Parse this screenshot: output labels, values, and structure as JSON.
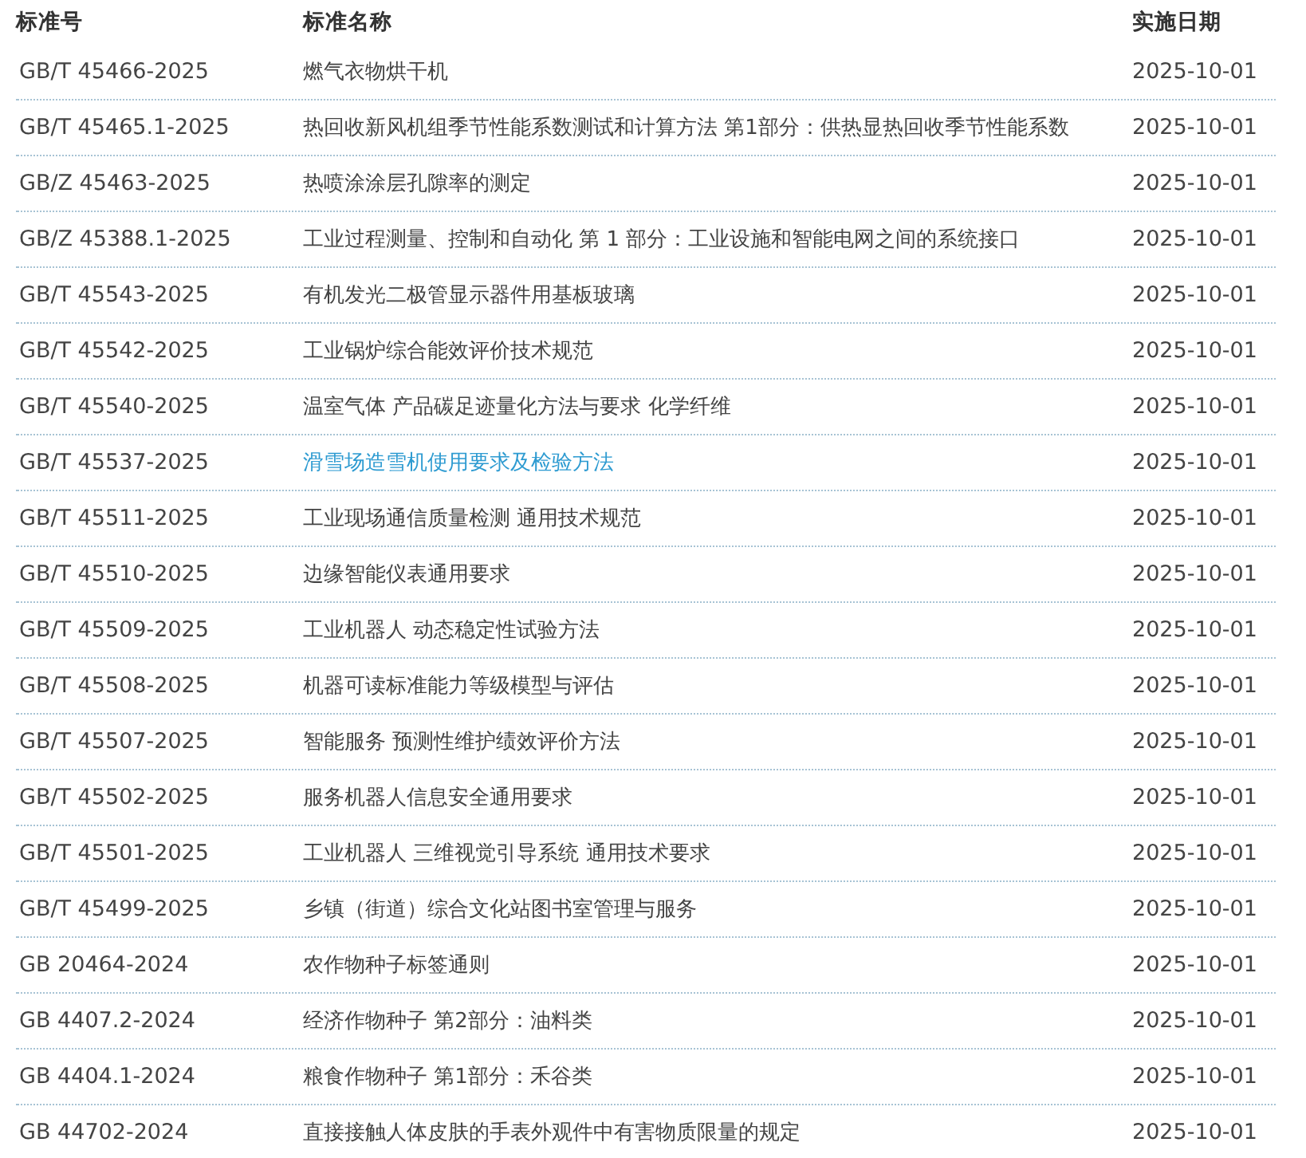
{
  "table": {
    "columns": [
      "标准号",
      "标准名称",
      "实施日期"
    ],
    "rows": [
      {
        "code": "GB/T 45466-2025",
        "name": "燃气衣物烘干机",
        "date": "2025-10-01",
        "highlighted": false
      },
      {
        "code": "GB/T 45465.1-2025",
        "name": "热回收新风机组季节性能系数测试和计算方法 第1部分：供热显热回收季节性能系数",
        "date": "2025-10-01",
        "highlighted": false
      },
      {
        "code": "GB/Z 45463-2025",
        "name": "热喷涂涂层孔隙率的测定",
        "date": "2025-10-01",
        "highlighted": false
      },
      {
        "code": "GB/Z 45388.1-2025",
        "name": "工业过程测量、控制和自动化 第 1 部分：工业设施和智能电网之间的系统接口",
        "date": "2025-10-01",
        "highlighted": false
      },
      {
        "code": "GB/T 45543-2025",
        "name": "有机发光二极管显示器件用基板玻璃",
        "date": "2025-10-01",
        "highlighted": false
      },
      {
        "code": "GB/T 45542-2025",
        "name": "工业锅炉综合能效评价技术规范",
        "date": "2025-10-01",
        "highlighted": false
      },
      {
        "code": "GB/T 45540-2025",
        "name": "温室气体 产品碳足迹量化方法与要求 化学纤维",
        "date": "2025-10-01",
        "highlighted": false
      },
      {
        "code": "GB/T 45537-2025",
        "name": "滑雪场造雪机使用要求及检验方法",
        "date": "2025-10-01",
        "highlighted": true
      },
      {
        "code": "GB/T 45511-2025",
        "name": "工业现场通信质量检测 通用技术规范",
        "date": "2025-10-01",
        "highlighted": false
      },
      {
        "code": "GB/T 45510-2025",
        "name": "边缘智能仪表通用要求",
        "date": "2025-10-01",
        "highlighted": false
      },
      {
        "code": "GB/T 45509-2025",
        "name": "工业机器人 动态稳定性试验方法",
        "date": "2025-10-01",
        "highlighted": false
      },
      {
        "code": "GB/T 45508-2025",
        "name": "机器可读标准能力等级模型与评估",
        "date": "2025-10-01",
        "highlighted": false
      },
      {
        "code": "GB/T 45507-2025",
        "name": "智能服务 预测性维护绩效评价方法",
        "date": "2025-10-01",
        "highlighted": false
      },
      {
        "code": "GB/T 45502-2025",
        "name": "服务机器人信息安全通用要求",
        "date": "2025-10-01",
        "highlighted": false
      },
      {
        "code": "GB/T 45501-2025",
        "name": "工业机器人 三维视觉引导系统 通用技术要求",
        "date": "2025-10-01",
        "highlighted": false
      },
      {
        "code": "GB/T 45499-2025",
        "name": "乡镇（街道）综合文化站图书室管理与服务",
        "date": "2025-10-01",
        "highlighted": false
      },
      {
        "code": "GB 20464-2024",
        "name": "农作物种子标签通则",
        "date": "2025-10-01",
        "highlighted": false
      },
      {
        "code": "GB 4407.2-2024",
        "name": "经济作物种子 第2部分：油料类",
        "date": "2025-10-01",
        "highlighted": false
      },
      {
        "code": "GB 4404.1-2024",
        "name": "粮食作物种子 第1部分：禾谷类",
        "date": "2025-10-01",
        "highlighted": false
      },
      {
        "code": "GB 44702-2024",
        "name": "直接接触人体皮肤的手表外观件中有害物质限量的规定",
        "date": "2025-10-01",
        "highlighted": false
      }
    ]
  }
}
